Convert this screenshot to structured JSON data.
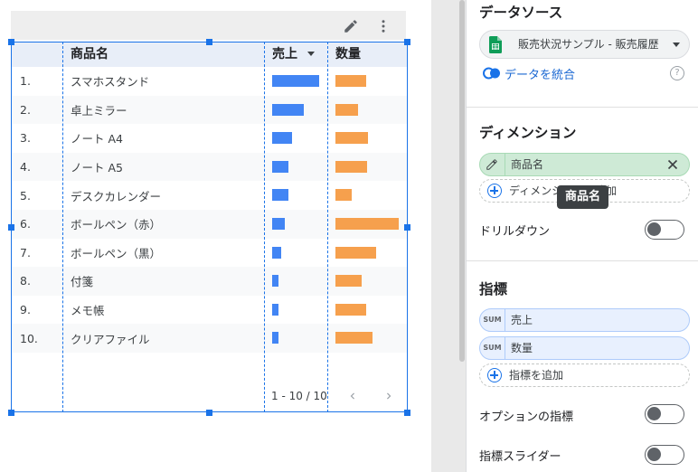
{
  "table": {
    "headers": {
      "name": "商品名",
      "sales": "売上",
      "qty": "数量"
    },
    "rows": [
      {
        "num": "1.",
        "name": "スマホスタンド",
        "sales": 1.0,
        "qty": 0.48
      },
      {
        "num": "2.",
        "name": "卓上ミラー",
        "sales": 0.67,
        "qty": 0.35
      },
      {
        "num": "3.",
        "name": "ノート A4",
        "sales": 0.42,
        "qty": 0.52
      },
      {
        "num": "4.",
        "name": "ノート A5",
        "sales": 0.35,
        "qty": 0.5
      },
      {
        "num": "5.",
        "name": "デスクカレンダー",
        "sales": 0.35,
        "qty": 0.25
      },
      {
        "num": "6.",
        "name": "ボールペン（赤）",
        "sales": 0.27,
        "qty": 1.0
      },
      {
        "num": "7.",
        "name": "ボールペン（黒）",
        "sales": 0.19,
        "qty": 0.64
      },
      {
        "num": "8.",
        "name": "付箋",
        "sales": 0.13,
        "qty": 0.42
      },
      {
        "num": "9.",
        "name": "メモ帳",
        "sales": 0.13,
        "qty": 0.49
      },
      {
        "num": "10.",
        "name": "クリアファイル",
        "sales": 0.13,
        "qty": 0.59
      }
    ],
    "pagination": "1 - 10 / 10"
  },
  "panel": {
    "datasource": {
      "title": "データソース",
      "source_name": "販売状況サンプル - 販売履歴",
      "blend_label": "データを統合",
      "help_glyph": "?"
    },
    "dimension": {
      "title": "ディメンション",
      "chip_label": "商品名",
      "add_label": "ディメンションを追加",
      "tooltip": "商品名",
      "drilldown_label": "ドリルダウン"
    },
    "metrics": {
      "title": "指標",
      "items": [
        {
          "agg": "SUM",
          "label": "売上"
        },
        {
          "agg": "SUM",
          "label": "数量"
        }
      ],
      "add_label": "指標を追加",
      "optional_label": "オプションの指標",
      "slider_label": "指標スライダー"
    }
  },
  "colors": {
    "sales_bar": "#4285f4",
    "qty_bar": "#f6a04d",
    "selection": "#1a73e8",
    "dimension_chip": "#ceead6",
    "metric_chip": "#e8f0fe"
  }
}
